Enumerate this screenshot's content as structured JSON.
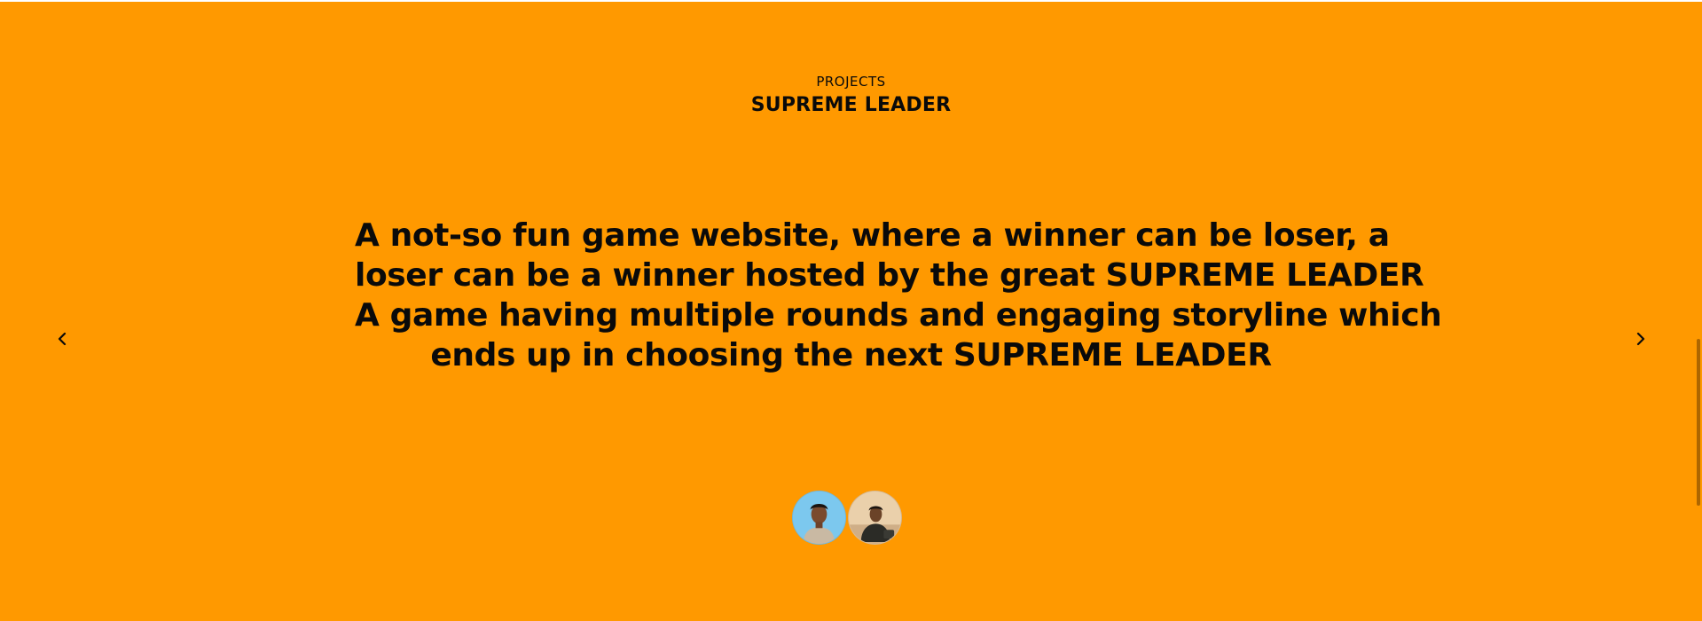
{
  "section": {
    "kicker": "PROJECTS",
    "title": "SUPREME LEADER"
  },
  "description": {
    "lines": [
      "A not-so fun game website, where a winner can be loser, a",
      "loser can be a winner hosted by the great SUPREME LEADER",
      "A game having multiple rounds and engaging storyline which",
      "ends up in choosing the next SUPREME LEADER"
    ]
  },
  "navigation": {
    "prev_icon": "chevron-left-icon",
    "next_icon": "chevron-right-icon"
  },
  "contributors": [
    {
      "icon": "avatar-photo-1"
    },
    {
      "icon": "avatar-photo-2"
    }
  ],
  "colors": {
    "background": "#ff9900",
    "text": "#0a0a0a"
  }
}
